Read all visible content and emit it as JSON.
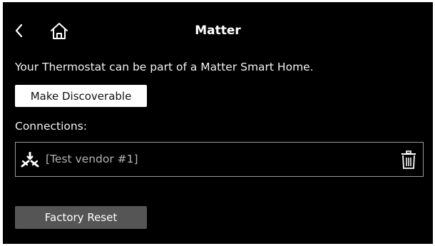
{
  "header": {
    "title": "Matter",
    "back_icon": "chevron-left-icon",
    "home_icon": "home-icon"
  },
  "main": {
    "description": "Your Thermostat can be part of a Matter Smart Home.",
    "make_discoverable_label": "Make Discoverable",
    "connections_label": "Connections:",
    "connections": [
      {
        "name": "[Test vendor #1]",
        "icon": "matter-logo-icon",
        "action_icon": "trash-icon"
      }
    ],
    "factory_reset_label": "Factory Reset"
  },
  "colors": {
    "background": "#000000",
    "primary_button_bg": "#ffffff",
    "secondary_button_bg": "#555555",
    "muted_text": "#b3b3b3",
    "border": "#9a9a9a"
  }
}
